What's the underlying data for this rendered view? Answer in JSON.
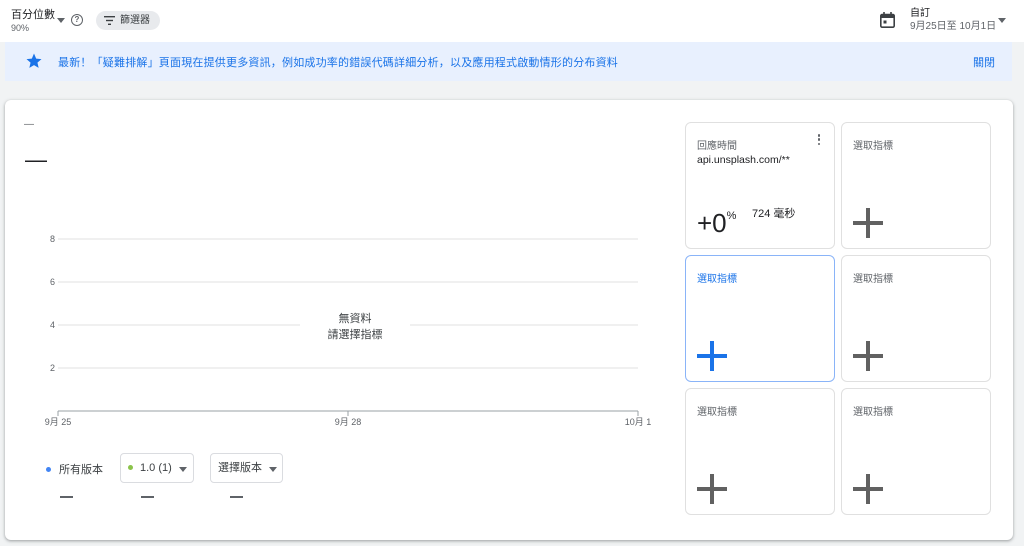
{
  "topbar": {
    "percentile_label": "百分位數",
    "percentile_value": "90%",
    "filter_label": "篩選器",
    "date_preset": "自訂",
    "date_range": "9月25日至 10月1日"
  },
  "banner": {
    "message": "最新！「疑難排解」頁面現在提供更多資訊，例如成功率的錯誤代碼詳細分析，以及應用程式啟動情形的分布資料",
    "close_label": "關閉"
  },
  "summary": {
    "small_value": "—",
    "big_value": "—"
  },
  "chart_data": {
    "type": "line",
    "y_ticks": [
      "8",
      "6",
      "4",
      "2"
    ],
    "x_ticks": [
      "9月 25",
      "9月 28",
      "10月 1"
    ],
    "ylim": [
      0,
      8
    ],
    "grid": true,
    "series": [],
    "empty_title": "無資料",
    "empty_subtitle": "請選擇指標"
  },
  "legend": {
    "all_versions": "所有版本",
    "version_1": "1.0 (1)",
    "select_version": "選擇版本",
    "value_all": "—",
    "value_v1": "—",
    "value_select": "—"
  },
  "metrics": {
    "response_time": {
      "title": "回應時間",
      "endpoint": "api.unsplash.com/**",
      "change_number": "+0",
      "change_unit": "%",
      "value": "724 毫秒"
    },
    "empty_label": "選取指標"
  },
  "colors": {
    "accent": "#1a73e8",
    "banner_bg": "#e8f0fe",
    "all_versions_dot": "#4285f4",
    "version_1_dot": "#8bc34a"
  }
}
